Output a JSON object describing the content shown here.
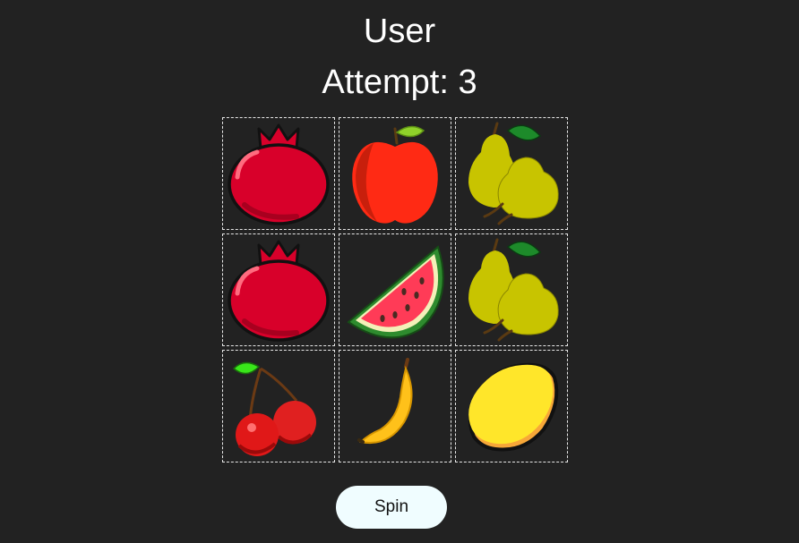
{
  "header": {
    "user": "User",
    "attempt": "Attempt: 3"
  },
  "grid": {
    "cells": [
      {
        "fruit": "pomegranate-icon"
      },
      {
        "fruit": "apple-icon"
      },
      {
        "fruit": "pear-icon"
      },
      {
        "fruit": "pomegranate-icon"
      },
      {
        "fruit": "watermelon-icon"
      },
      {
        "fruit": "pear-icon"
      },
      {
        "fruit": "cherry-icon"
      },
      {
        "fruit": "banana-icon"
      },
      {
        "fruit": "lemon-icon"
      }
    ]
  },
  "controls": {
    "spin_label": "Spin"
  },
  "colors": {
    "background": "#222222",
    "button_bg": "#f0fdff",
    "cell_border": "#e8e8e8"
  }
}
